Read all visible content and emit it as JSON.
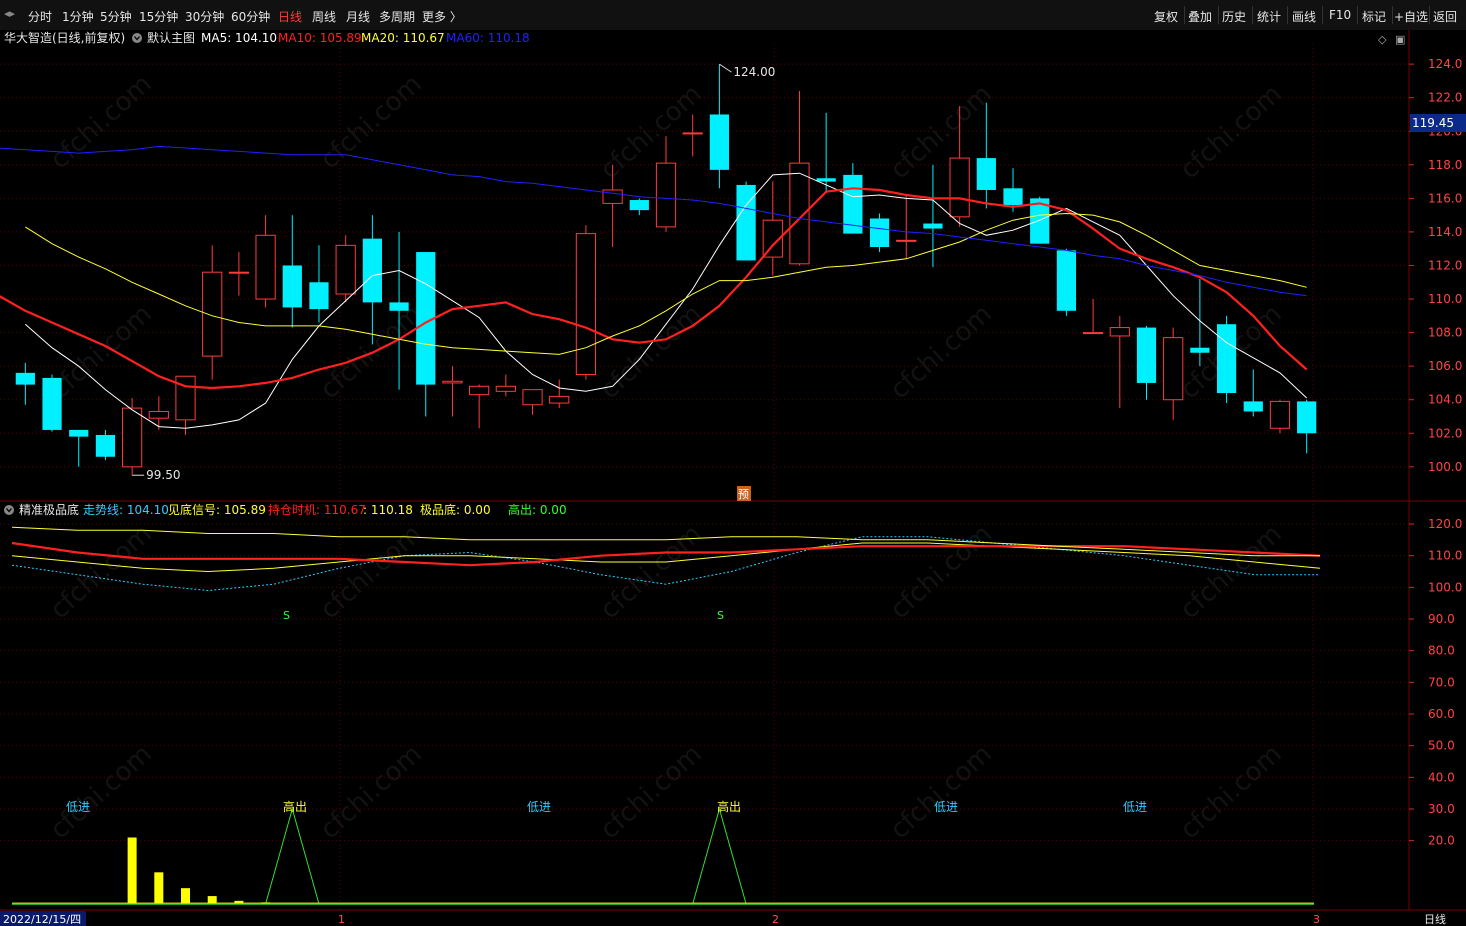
{
  "toolbar": {
    "nav_glyph": "◂▸",
    "periods": [
      "分时",
      "1分钟",
      "5分钟",
      "15分钟",
      "30分钟",
      "60分钟",
      "日线",
      "周线",
      "月线",
      "多周期",
      "更多 〉"
    ],
    "active_period": "日线",
    "right_buttons": [
      "复权",
      "叠加",
      "历史",
      "统计",
      "画线",
      "F10",
      "标记",
      "+自选",
      "返回"
    ]
  },
  "main_panel": {
    "stock_title": "华大智造(日线,前复权)",
    "template_icon": "chevron-down-icon",
    "template_label": "默认主图",
    "ma5": {
      "label": "MA5: 104.10",
      "color": "#ffffff"
    },
    "ma10": {
      "label": "MA10: 105.89",
      "color": "#ff2020"
    },
    "ma20": {
      "label": "MA20: 110.67",
      "color": "#ffff33"
    },
    "ma60": {
      "label": "MA60: 110.18",
      "color": "#2020ff"
    },
    "current_price": "119.45",
    "max_annotation": "124.00",
    "min_annotation": "99.50",
    "forecast_badge": "预",
    "corner_icons": [
      "◇",
      "▣"
    ]
  },
  "indicator_panel": {
    "title": "精准极品底",
    "labels": [
      {
        "text": "走势线: 104.10",
        "color": "#33ccff"
      },
      {
        "text": "见底信号: 105.89",
        "color": "#ffff33"
      },
      {
        "text": "持仓时机: 110.67",
        "color": "#ff2020"
      },
      {
        "text": ": 110.18",
        "color": "#ffff33"
      },
      {
        "text": "极品底: 0.00",
        "color": "#ffff33"
      },
      {
        "text": "高出: 0.00",
        "color": "#33ff33"
      }
    ],
    "signal_labels": [
      "S",
      "S"
    ],
    "annotations": [
      "低进",
      "高出",
      "低进",
      "高出",
      "低进",
      "低进"
    ]
  },
  "bottom_axis": {
    "date_label": "2022/12/15/四",
    "month_marks": [
      "1",
      "2",
      "3"
    ],
    "period_label": "日线"
  },
  "watermark": "cfchi.com",
  "chart_data": [
    {
      "type": "candlestick",
      "ylim": [
        98.5,
        125.2
      ],
      "y_ticks": [
        100.0,
        102.0,
        104.0,
        106.0,
        108.0,
        110.0,
        112.0,
        114.0,
        116.0,
        118.0,
        120.0,
        122.0,
        124.0
      ],
      "ohlc": [
        [
          105.6,
          106.2,
          103.7,
          104.9
        ],
        [
          105.3,
          105.5,
          102.1,
          102.2
        ],
        [
          102.2,
          102.2,
          100.0,
          101.8
        ],
        [
          101.9,
          102.2,
          100.4,
          100.6
        ],
        [
          100.0,
          104.1,
          99.5,
          103.5
        ],
        [
          102.9,
          104.2,
          102.2,
          103.3
        ],
        [
          102.8,
          104.2,
          101.9,
          105.4
        ],
        [
          106.6,
          113.2,
          105.2,
          111.6
        ],
        [
          111.6,
          112.8,
          110.2,
          111.6
        ],
        [
          110.0,
          115.0,
          109.5,
          113.8
        ],
        [
          112.0,
          115.0,
          108.3,
          109.5
        ],
        [
          111.0,
          113.2,
          108.6,
          109.4
        ],
        [
          110.3,
          113.8,
          109.8,
          113.2
        ],
        [
          113.6,
          115.0,
          107.3,
          109.8
        ],
        [
          109.8,
          114.0,
          104.6,
          109.3
        ],
        [
          112.8,
          112.8,
          103.0,
          104.9
        ],
        [
          105.0,
          106.0,
          103.0,
          105.1
        ],
        [
          104.3,
          104.9,
          102.3,
          104.8
        ],
        [
          104.5,
          105.5,
          104.2,
          104.8
        ],
        [
          103.7,
          104.6,
          103.1,
          104.6
        ],
        [
          103.8,
          105.2,
          103.5,
          104.2
        ],
        [
          105.5,
          114.4,
          105.2,
          113.9
        ],
        [
          115.7,
          118.0,
          113.1,
          116.5
        ],
        [
          115.9,
          116.0,
          115.0,
          115.3
        ],
        [
          114.3,
          119.7,
          114.0,
          118.1
        ],
        [
          119.9,
          121.0,
          118.5,
          119.9
        ],
        [
          121.0,
          124.0,
          116.6,
          117.7
        ],
        [
          116.8,
          117.0,
          112.3,
          112.3
        ],
        [
          112.5,
          117.0,
          111.4,
          114.7
        ],
        [
          112.1,
          122.4,
          112.0,
          118.1
        ],
        [
          117.2,
          121.1,
          116.4,
          117.0
        ],
        [
          117.4,
          118.1,
          113.9,
          113.9
        ],
        [
          114.8,
          115.1,
          112.8,
          113.1
        ],
        [
          113.5,
          116.2,
          112.4,
          113.5
        ],
        [
          114.5,
          118.0,
          111.9,
          114.2
        ],
        [
          114.9,
          121.5,
          114.3,
          118.4
        ],
        [
          118.4,
          121.7,
          115.4,
          116.5
        ],
        [
          116.6,
          117.8,
          115.2,
          115.6
        ],
        [
          116.0,
          116.1,
          113.3,
          113.3
        ],
        [
          112.9,
          113.0,
          109.0,
          109.3
        ],
        [
          108.0,
          110.0,
          108.0,
          108.0
        ],
        [
          107.8,
          109.0,
          103.5,
          108.3
        ],
        [
          108.3,
          108.4,
          104.0,
          105.0
        ],
        [
          104.0,
          108.3,
          102.8,
          107.7
        ],
        [
          107.1,
          111.2,
          106.0,
          106.8
        ],
        [
          108.5,
          109.0,
          103.8,
          104.4
        ],
        [
          103.9,
          105.8,
          103.0,
          103.3
        ],
        [
          102.3,
          104.0,
          102.0,
          103.9
        ],
        [
          103.9,
          104.0,
          100.8,
          102.0
        ]
      ],
      "series": [
        {
          "name": "MA5",
          "color": "#ffffff",
          "values": [
            108.5,
            107.1,
            106.0,
            104.6,
            103.4,
            102.4,
            102.3,
            102.5,
            102.8,
            103.8,
            106.4,
            108.4,
            109.9,
            111.4,
            111.7,
            110.9,
            109.9,
            108.9,
            106.9,
            105.5,
            104.7,
            104.5,
            104.8,
            106.4,
            108.5,
            110.6,
            113.2,
            115.6,
            117.4,
            117.5,
            116.8,
            116.1,
            116.2,
            116.0,
            115.9,
            114.5,
            113.8,
            114.1,
            114.7,
            115.4,
            114.6,
            113.8,
            112.0,
            110.2,
            108.7,
            107.4,
            106.5,
            105.6,
            104.1
          ]
        },
        {
          "name": "MA10",
          "color": "#ff2020",
          "values": [
            111.0,
            110.2,
            109.3,
            108.6,
            107.9,
            107.2,
            106.3,
            105.4,
            104.8,
            104.7,
            104.8,
            105.0,
            105.3,
            105.8,
            106.2,
            106.8,
            107.6,
            108.6,
            109.4,
            109.6,
            109.8,
            109.1,
            108.8,
            108.3,
            107.6,
            107.4,
            107.6,
            108.4,
            109.6,
            111.3,
            113.2,
            114.8,
            116.4,
            116.6,
            116.5,
            116.2,
            116.0,
            116.0,
            115.7,
            115.5,
            115.7,
            115.3,
            114.2,
            113.0,
            112.4,
            111.9,
            111.3,
            110.4,
            109.0,
            107.2,
            105.8
          ]
        },
        {
          "name": "MA20",
          "color": "#ffff33",
          "values": [
            114.3,
            113.3,
            112.5,
            111.8,
            111.0,
            110.3,
            109.6,
            109.0,
            108.6,
            108.4,
            108.4,
            108.4,
            108.2,
            107.9,
            107.6,
            107.3,
            107.1,
            107.0,
            106.9,
            106.8,
            106.7,
            107.1,
            107.8,
            108.4,
            109.3,
            110.3,
            111.1,
            111.1,
            111.3,
            111.6,
            111.9,
            112.0,
            112.2,
            112.4,
            112.9,
            113.4,
            114.1,
            114.7,
            115.0,
            115.1,
            115.0,
            114.6,
            113.8,
            112.9,
            112.0,
            111.7,
            111.4,
            111.1,
            110.7
          ]
        },
        {
          "name": "MA60",
          "color": "#2020ff",
          "values": [
            119.0,
            118.9,
            118.8,
            118.7,
            118.8,
            118.9,
            119.1,
            119.0,
            118.9,
            118.8,
            118.7,
            118.6,
            118.6,
            118.6,
            118.3,
            118.0,
            117.7,
            117.4,
            117.3,
            117.0,
            116.9,
            116.7,
            116.5,
            116.3,
            116.1,
            116.0,
            115.9,
            115.7,
            115.4,
            115.1,
            114.8,
            114.6,
            114.4,
            114.2,
            114.0,
            113.9,
            113.7,
            113.5,
            113.3,
            113.1,
            112.9,
            112.6,
            112.4,
            112.0,
            111.7,
            111.4,
            111.0,
            110.7,
            110.4,
            110.2
          ]
        }
      ]
    },
    {
      "type": "line",
      "ylim": [
        0,
        126
      ],
      "y_ticks": [
        20.0,
        30.0,
        40.0,
        50.0,
        60.0,
        70.0,
        80.0,
        90.0,
        100.0,
        110.0,
        120.0
      ],
      "series": [
        {
          "name": "走势线",
          "color": "#33ccff",
          "style": "dashed",
          "values": [
            107,
            104,
            101,
            99,
            101,
            106,
            110,
            111,
            108,
            104,
            101,
            105,
            111,
            116,
            116,
            114,
            112,
            110,
            107,
            104,
            104
          ]
        },
        {
          "name": "见底信号",
          "color": "#ffff33",
          "values": [
            110,
            108,
            106,
            105,
            106,
            108,
            110,
            110,
            109,
            108,
            108,
            110,
            112,
            114,
            114,
            113,
            112,
            111,
            110,
            108,
            106
          ]
        },
        {
          "name": "持仓时机",
          "color": "#ff2020",
          "style": "thick",
          "values": [
            114,
            111,
            109,
            109,
            109,
            109,
            108,
            107,
            108,
            110,
            111,
            111,
            112,
            113,
            113,
            113,
            113,
            113,
            112,
            111,
            110
          ]
        },
        {
          "name": "",
          "color": "#ffff33",
          "values": [
            119,
            118,
            118,
            117,
            117,
            116,
            116,
            115,
            115,
            115,
            115,
            116,
            116,
            115,
            115,
            114,
            113,
            112,
            111,
            110,
            110
          ]
        }
      ],
      "sell_bars": [
        {
          "index": 4,
          "value": 21
        },
        {
          "index": 5,
          "value": 10
        },
        {
          "index": 6,
          "value": 5
        },
        {
          "index": 7,
          "value": 2.5
        },
        {
          "index": 8,
          "value": 1
        },
        {
          "index": 9,
          "value": 0.5
        }
      ],
      "peaks": [
        {
          "index": 10,
          "value": 30
        },
        {
          "index": 26,
          "value": 30
        }
      ]
    }
  ]
}
